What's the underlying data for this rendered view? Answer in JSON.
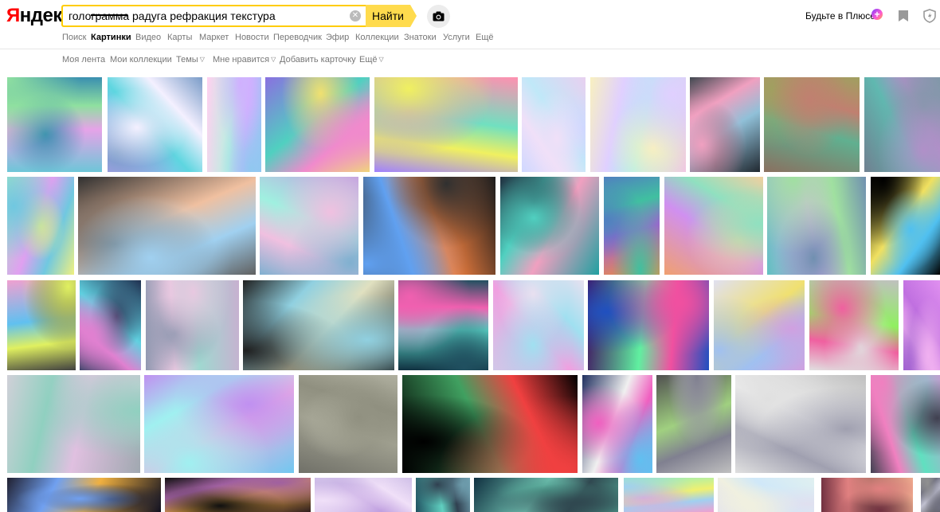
{
  "header": {
    "logo": "Яндекс",
    "search_value": "голограмма радуга рефракция текстура",
    "find_label": "Найти",
    "plus_label": "Будьте в Плюсе"
  },
  "tabs": [
    "Поиск",
    "Картинки",
    "Видео",
    "Карты",
    "Маркет",
    "Новости",
    "Переводчик",
    "Эфир",
    "Коллекции",
    "Знатоки",
    "Услуги",
    "Ещё"
  ],
  "active_tab": "Картинки",
  "subnav": [
    "Моя лента",
    "Мои коллекции",
    "Темы",
    "Мне нравится",
    "Добавить карточку",
    "Ещё"
  ],
  "colors": {
    "accent": "#ffdb4d",
    "search_border": "#ffcc00",
    "logo_red": "#ff0000"
  },
  "images": [
    {
      "colors": [
        "#6ec6d8",
        "#e6a3e8",
        "#8fe0a0",
        "#3a8fb0"
      ]
    },
    {
      "colors": [
        "#c8a0ff",
        "#5ed6e0",
        "#f4f0ff",
        "#7a9cc8"
      ]
    },
    {
      "colors": [
        "#ffd0f0",
        "#b8f0e0",
        "#d0b0ff",
        "#90c8f0"
      ]
    },
    {
      "colors": [
        "#8a70e0",
        "#50d0c0",
        "#f08acc",
        "#f0e070"
      ]
    },
    {
      "colors": [
        "#ff90b0",
        "#70e0c0",
        "#f0f060",
        "#a080ff"
      ]
    },
    {
      "colors": [
        "#e8d0f0",
        "#c0e8f8",
        "#f0e0f8",
        "#d0d8ff"
      ]
    },
    {
      "colors": [
        "#f0c0e8",
        "#a8f0f0",
        "#e0d0ff",
        "#f8f0c0"
      ]
    },
    {
      "colors": [
        "#202830",
        "#90c0d8",
        "#f0a0c0",
        "#404850"
      ]
    },
    {
      "colors": [
        "#8a7060",
        "#60b090",
        "#c08070",
        "#a0a060"
      ]
    },
    {
      "colors": [
        "#708090",
        "#60b8b0",
        "#b090c8",
        "#8098a8"
      ]
    },
    {
      "colors": [
        "#a0e8c0",
        "#e0a0f0",
        "#70c8e0",
        "#f0f080"
      ]
    },
    {
      "colors": [
        "#303030",
        "#f0c0a0",
        "#a0d0f0",
        "#606060"
      ]
    },
    {
      "colors": [
        "#c0a0e0",
        "#a0f0e0",
        "#f0c0e0",
        "#80b0d0"
      ]
    },
    {
      "colors": [
        "#181818",
        "#f08040",
        "#60a0f0",
        "#303030"
      ]
    },
    {
      "colors": [
        "#20a0a0",
        "#f0a0c0",
        "#50d0c0",
        "#203040"
      ]
    },
    {
      "colors": [
        "#f09040",
        "#a060d0",
        "#40c0a0",
        "#5080c0"
      ]
    },
    {
      "colors": [
        "#f0a070",
        "#d090f0",
        "#90e0c0",
        "#f0d0a0"
      ]
    },
    {
      "colors": [
        "#60c0c0",
        "#e0b0f0",
        "#a0e0a0",
        "#7090b0"
      ]
    },
    {
      "colors": [
        "#000000",
        "#f0e060",
        "#50c0f0",
        "#000000"
      ]
    },
    {
      "colors": [
        "#f0a0d0",
        "#60c0f0",
        "#e0f060",
        "#404040"
      ]
    },
    {
      "colors": [
        "#203050",
        "#60d0e0",
        "#e080d0",
        "#304060"
      ]
    },
    {
      "colors": [
        "#c8b0d0",
        "#a0d8d0",
        "#e8c8e0",
        "#9098b0"
      ]
    },
    {
      "colors": [
        "#101010",
        "#e0e0c0",
        "#90d0e0",
        "#202020"
      ]
    },
    {
      "colors": [
        "#103040",
        "#60e0d0",
        "#f060b0",
        "#205060"
      ]
    },
    {
      "colors": [
        "#d0c8e8",
        "#f0a0e0",
        "#a0e0f0",
        "#e8e0f0"
      ]
    },
    {
      "colors": [
        "#401060",
        "#60f0a0",
        "#f050a0",
        "#2050c0"
      ]
    },
    {
      "colors": [
        "#e0e0f0",
        "#f0e070",
        "#a0c0f0",
        "#d0a0e0"
      ]
    },
    {
      "colors": [
        "#c0c0c0",
        "#90f060",
        "#f060a0",
        "#e0e0e0"
      ]
    },
    {
      "colors": [
        "#e090f0",
        "#c070e0",
        "#f0b0f0",
        "#a060d0"
      ]
    },
    {
      "colors": [
        "#a0a8b0",
        "#e0c0e0",
        "#90d0c0",
        "#d0d0d8"
      ]
    },
    {
      "colors": [
        "#70c8f0",
        "#f0b0e0",
        "#a0f0f0",
        "#c090f0"
      ]
    },
    {
      "colors": [
        "#707068",
        "#a0a090",
        "#909080",
        "#b0b0a0"
      ]
    },
    {
      "colors": [
        "#000000",
        "#40a060",
        "#f04040",
        "#000000"
      ]
    },
    {
      "colors": [
        "#203060",
        "#f0f0f0",
        "#f060c0",
        "#60c0f0"
      ]
    },
    {
      "colors": [
        "#505050",
        "#a0d080",
        "#808090",
        "#c0c0c0"
      ]
    },
    {
      "colors": [
        "#c0c0c0",
        "#f0f0f0",
        "#a0a0b0",
        "#e0e0e0"
      ]
    },
    {
      "colors": [
        "#c0a0d0",
        "#60e0c0",
        "#f080c0",
        "#404050"
      ]
    },
    {
      "colors": [
        "#101020",
        "#f0b040",
        "#70a0f0",
        "#202030"
      ]
    },
    {
      "colors": [
        "#302020",
        "#e0a040",
        "#a060a0",
        "#101010"
      ]
    },
    {
      "colors": [
        "#e0d0f0",
        "#c0a0e0",
        "#f0e0f8",
        "#d0c0e8"
      ]
    },
    {
      "colors": [
        "#205060",
        "#60d0c0",
        "#304050",
        "#70a0b0"
      ]
    },
    {
      "colors": [
        "#103040",
        "#70c0b0",
        "#304850",
        "#50a090"
      ]
    },
    {
      "colors": [
        "#90f0c0",
        "#f0f070",
        "#a0d0f0",
        "#f0a0d0"
      ]
    },
    {
      "colors": [
        "#e0f0f0",
        "#d0e8f8",
        "#f0f0e0",
        "#e0e0f0"
      ]
    },
    {
      "colors": [
        "#f0b090",
        "#a07060",
        "#e08080",
        "#703040"
      ]
    },
    {
      "colors": [
        "#404040",
        "#c0c0d0",
        "#707080",
        "#909090"
      ]
    }
  ]
}
